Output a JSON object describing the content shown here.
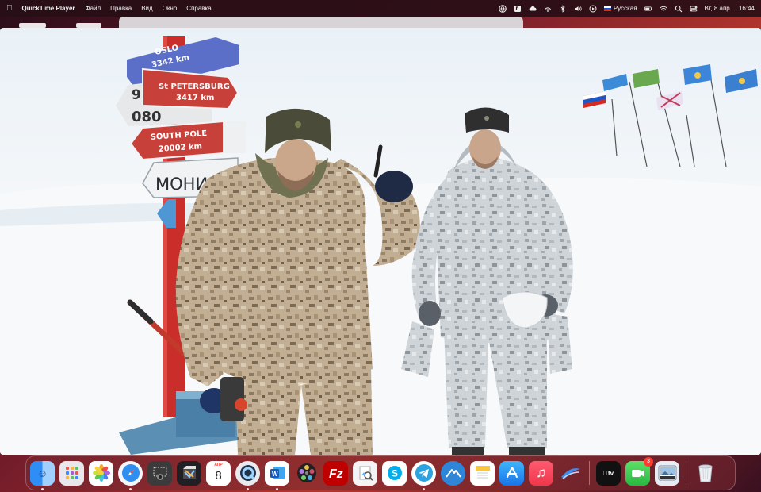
{
  "menubar": {
    "apple_icon": "apple-icon",
    "app_name": "QuickTime Player",
    "menus": [
      "Файл",
      "Правка",
      "Вид",
      "Окно",
      "Справка"
    ],
    "input_source": "Русская",
    "datetime": "Вт, 8 апр.",
    "time": "16:44"
  },
  "video": {
    "signs": {
      "oslo": {
        "city": "OSLO",
        "distance": "3342 km"
      },
      "st_petersburg": {
        "city": "St PETERSBURG",
        "distance": "3417 km"
      },
      "south_pole": {
        "city": "SOUTH POLE",
        "distance": "20002 km"
      },
      "monino": {
        "city": "МОНИН"
      },
      "partial": {
        "text": "9",
        "text2": "080"
      }
    },
    "colors": {
      "snow": "#ffffff",
      "sky": "#e9f1f7",
      "sign_red": "#c8403a",
      "sign_blue": "#5b6fc8",
      "sign_grey": "#e6e8ea",
      "pole_red": "#c92e2a",
      "camo_desert": "#b9a58a",
      "camo_grey": "#c7ccd1"
    }
  },
  "dock": {
    "items": [
      {
        "name": "finder",
        "icon": "finder-icon",
        "running": true
      },
      {
        "name": "launchpad",
        "icon": "launchpad-icon",
        "running": false
      },
      {
        "name": "photos",
        "icon": "photos-icon",
        "running": false
      },
      {
        "name": "safari",
        "icon": "safari-icon",
        "running": true
      },
      {
        "name": "screenshot",
        "icon": "screenshot-icon",
        "running": false
      },
      {
        "name": "final-cut-pro",
        "icon": "final-cut-icon",
        "running": false
      },
      {
        "name": "calendar",
        "icon": "calendar-icon",
        "running": false,
        "month": "АПР",
        "day": "8"
      },
      {
        "name": "quicktime",
        "icon": "quicktime-icon",
        "running": true
      },
      {
        "name": "word",
        "icon": "word-icon",
        "running": true
      },
      {
        "name": "video-player",
        "icon": "film-reel-icon",
        "running": false
      },
      {
        "name": "filezilla",
        "icon": "filezilla-icon",
        "running": false
      },
      {
        "name": "preview",
        "icon": "preview-icon",
        "running": false
      },
      {
        "name": "skype",
        "icon": "skype-icon",
        "running": false
      },
      {
        "name": "telegram",
        "icon": "telegram-icon",
        "running": true
      },
      {
        "name": "altitude",
        "icon": "mountain-icon",
        "running": false
      },
      {
        "name": "notes",
        "icon": "notes-icon",
        "running": false
      },
      {
        "name": "app-store",
        "icon": "app-store-icon",
        "running": false
      },
      {
        "name": "music",
        "icon": "music-icon",
        "running": false
      },
      {
        "name": "network-app",
        "icon": "swoosh-icon",
        "running": false
      },
      {
        "name": "apple-tv",
        "icon": "apple-tv-icon",
        "running": false,
        "label": "tv"
      },
      {
        "name": "facetime",
        "icon": "facetime-icon",
        "running": false,
        "badge": "3"
      },
      {
        "name": "image-viewer",
        "icon": "photo-thumbnail-icon",
        "running": false
      },
      {
        "name": "trash",
        "icon": "trash-icon",
        "running": false
      }
    ]
  }
}
